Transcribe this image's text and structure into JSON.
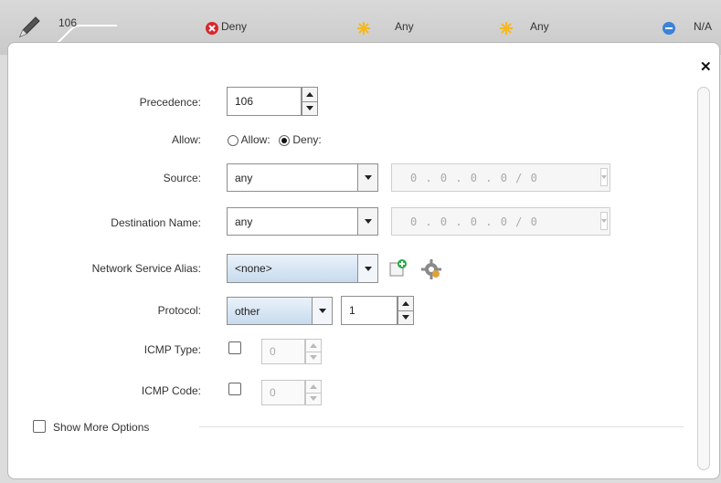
{
  "header": {
    "id_value": "106",
    "action": "Deny",
    "source": "Any",
    "destination": "Any",
    "service": "N/A"
  },
  "form": {
    "precedence": {
      "label": "Precedence:",
      "value": "106"
    },
    "allow": {
      "label": "Allow:",
      "option_allow": "Allow:",
      "option_deny": "Deny:",
      "selected": "Deny"
    },
    "source": {
      "label": "Source:",
      "value": "any",
      "ip": "0 . 0 . 0 . 0 / 0"
    },
    "destination": {
      "label": "Destination Name:",
      "value": "any",
      "ip": "0 . 0 . 0 . 0 / 0"
    },
    "network_service_alias": {
      "label": "Network Service Alias:",
      "value": "<none>"
    },
    "protocol": {
      "label": "Protocol:",
      "value": "other",
      "number": "1"
    },
    "icmp_type": {
      "label": "ICMP Type:",
      "value": "0"
    },
    "icmp_code": {
      "label": "ICMP Code:",
      "value": "0"
    },
    "show_more": {
      "label": "Show More Options"
    }
  },
  "colors": {
    "deny": "#d9262c",
    "any": "#f5b820",
    "na": "#3b82d9"
  },
  "icons": {
    "edit": "pencil-icon",
    "close": "close-icon",
    "add": "add-alias-icon",
    "settings": "gear-icon"
  }
}
